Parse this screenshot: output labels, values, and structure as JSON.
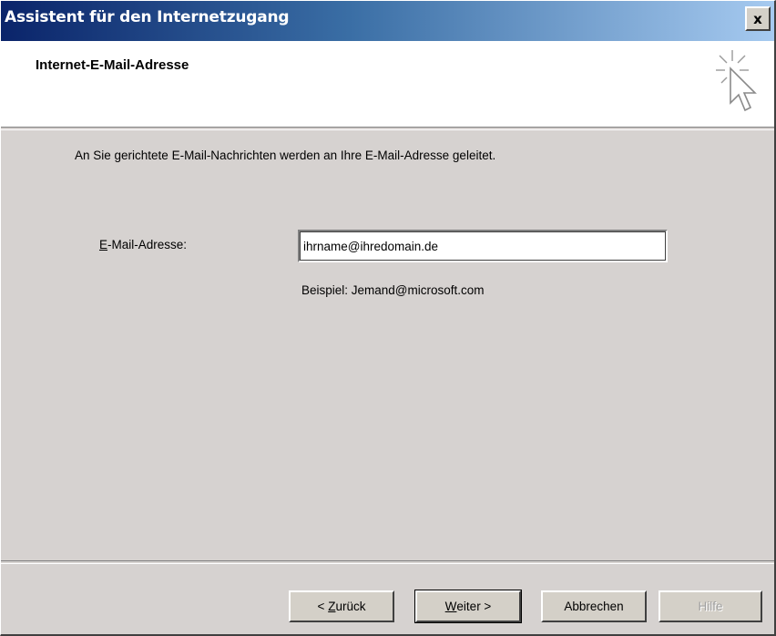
{
  "window": {
    "title": "Assistent für den Internetzugang",
    "close_glyph": "x"
  },
  "header": {
    "title": "Internet-E-Mail-Adresse",
    "icon": "wizard-cursor-icon"
  },
  "content": {
    "intro": "An Sie gerichtete E-Mail-Nachrichten werden an Ihre E-Mail-Adresse geleitet.",
    "email_label_mnemonic": "E",
    "email_label_rest": "-Mail-Adresse:",
    "email_value": "ihrname@ihredomain.de",
    "example": "Beispiel: Jemand@microsoft.com"
  },
  "buttons": {
    "back_prefix": "< ",
    "back_mnemonic": "Z",
    "back_rest": "urück",
    "next_mnemonic": "W",
    "next_rest": "eiter >",
    "cancel": "Abbrechen",
    "help": "Hilfe"
  }
}
